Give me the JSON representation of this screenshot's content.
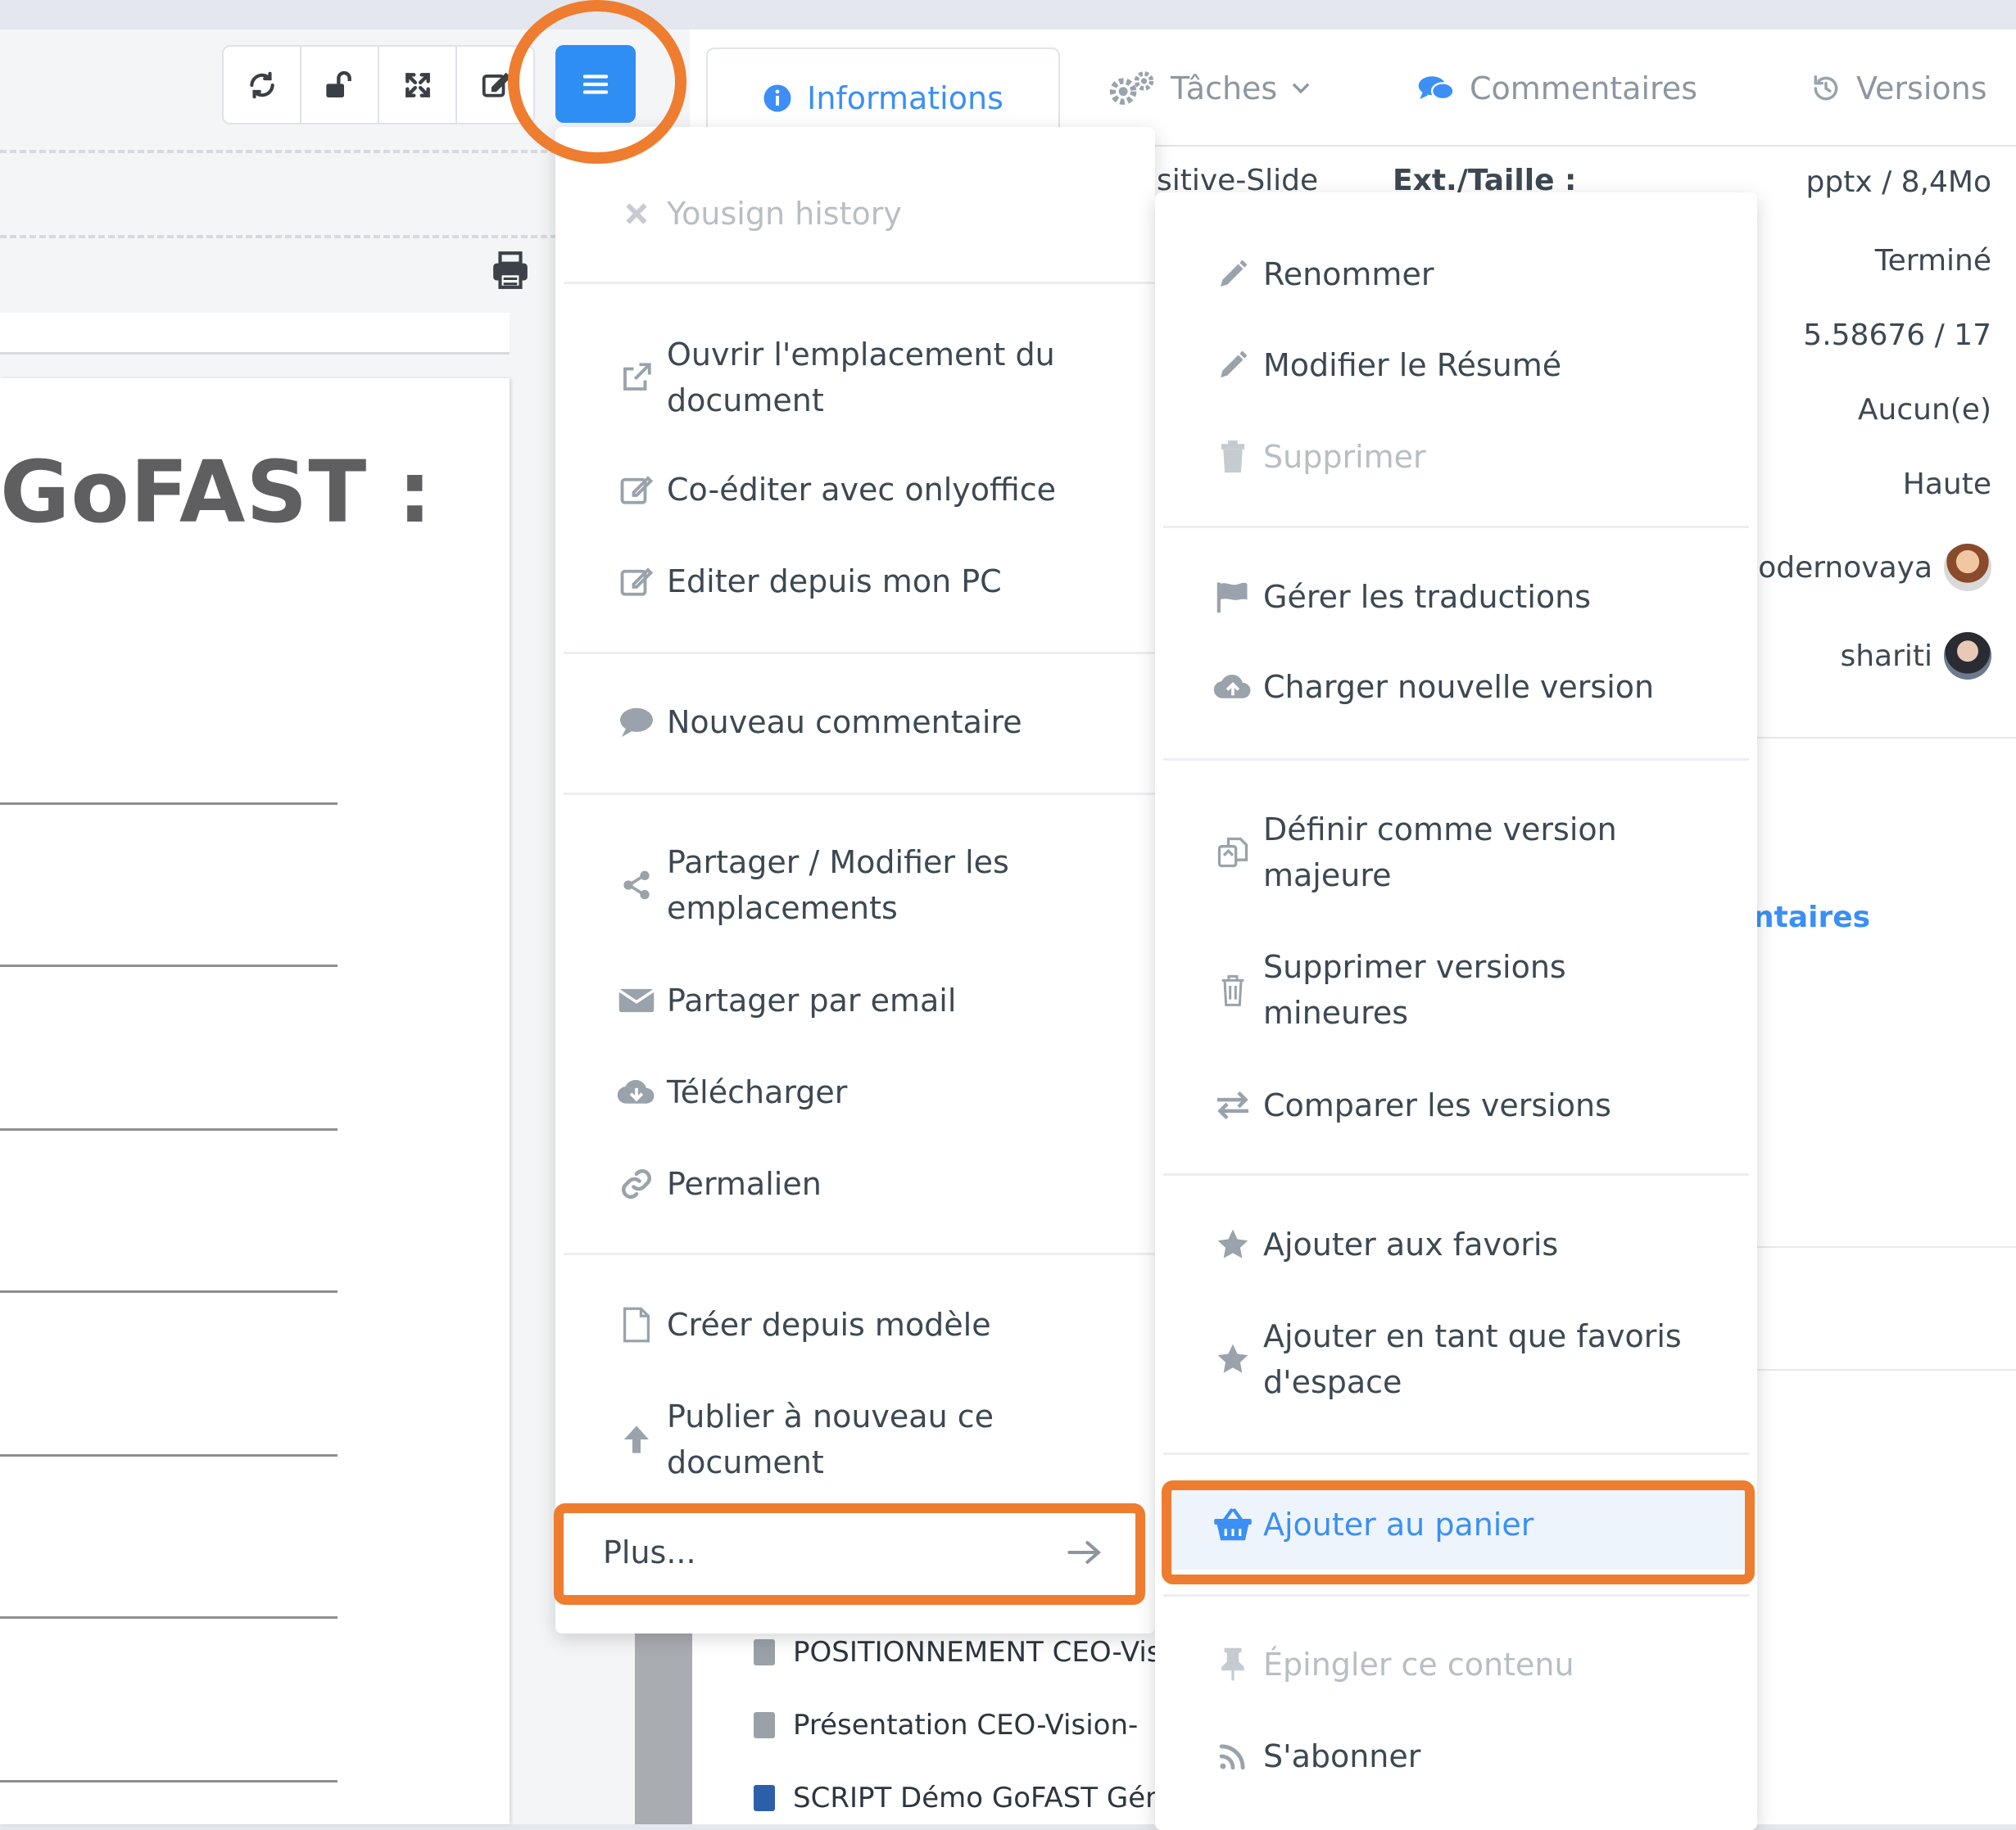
{
  "document": {
    "title": "GoFAST :"
  },
  "tabs": {
    "informations": "Informations",
    "taches": "Tâches",
    "commentaires": "Commentaires",
    "versions": "Versions"
  },
  "details": {
    "filename_fragment": "sitive-Slide",
    "ext_label": "Ext./Taille :",
    "ext_size": "pptx / 8,4Mo",
    "status": "Terminé",
    "version": "5.58676 / 17",
    "none_value": "Aucun(e)",
    "priority": "Haute",
    "user1": "odernovaya",
    "user2": "shariti",
    "comments_link": "ntaires"
  },
  "files": [
    "POSITIONNEMENT CEO-Vis",
    "Présentation CEO-Vision-",
    "SCRIPT Démo GoFAST Gén"
  ],
  "menu": {
    "yousign": "Yousign history",
    "ouvrir": "Ouvrir l'emplacement du document",
    "coediter": "Co-éditer avec onlyoffice",
    "editer": "Editer depuis mon PC",
    "commentaire": "Nouveau commentaire",
    "partager": "Partager / Modifier les emplacements",
    "email": "Partager par email",
    "telecharger": "Télécharger",
    "permalien": "Permalien",
    "modele": "Créer depuis modèle",
    "publier": "Publier à nouveau ce document",
    "plus": "Plus..."
  },
  "submenu": {
    "renommer": "Renommer",
    "resume": "Modifier le Résumé",
    "supprimer": "Supprimer",
    "traductions": "Gérer les traductions",
    "charger": "Charger nouvelle version",
    "majeure": "Définir comme version majeure",
    "mineures": "Supprimer versions mineures",
    "comparer": "Comparer les versions",
    "favoris": "Ajouter aux favoris",
    "favoris_espace": "Ajouter en tant que favoris d'espace",
    "panier": "Ajouter au panier",
    "epingler": "Épingler ce contenu",
    "abonner": "S'abonner"
  },
  "colors": {
    "accent": "#3b8ff5",
    "highlight": "#ee7d30",
    "menu_button": "#2f8ef4"
  }
}
